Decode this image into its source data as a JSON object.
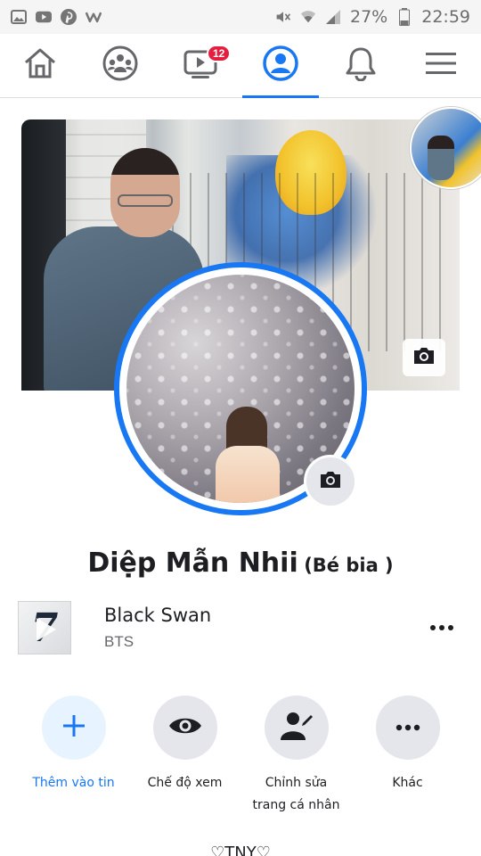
{
  "status_bar": {
    "left_icons": [
      "image-icon",
      "youtube-icon",
      "pinterest-icon",
      "w-icon"
    ],
    "right_icons": [
      "mute-icon",
      "wifi-icon",
      "signal-icon",
      "battery-icon"
    ],
    "battery": "27%",
    "time": "22:59"
  },
  "nav": {
    "items": [
      {
        "name": "home",
        "icon": "home-icon"
      },
      {
        "name": "groups",
        "icon": "groups-icon"
      },
      {
        "name": "watch",
        "icon": "watch-icon",
        "badge": "12"
      },
      {
        "name": "profile",
        "icon": "profile-icon",
        "active": true
      },
      {
        "name": "notifications",
        "icon": "bell-icon"
      },
      {
        "name": "menu",
        "icon": "hamburger-icon"
      }
    ],
    "accent": "#1877f2"
  },
  "profile": {
    "name": "Diệp Mẫn Nhii",
    "alternate_name": "(Bé bia )"
  },
  "music": {
    "title": "Black Swan",
    "artist": "BTS",
    "album_mark": "7"
  },
  "actions": [
    {
      "label": "Thêm vào tin",
      "icon": "plus-icon"
    },
    {
      "label": "Chế độ xem",
      "icon": "eye-icon"
    },
    {
      "label_line1": "Chỉnh sửa",
      "label_line2": "trang cá nhân",
      "icon": "edit-profile-icon"
    },
    {
      "label": "Khác",
      "icon": "more-icon"
    }
  ],
  "bottom_peek": "♡TNY♡"
}
